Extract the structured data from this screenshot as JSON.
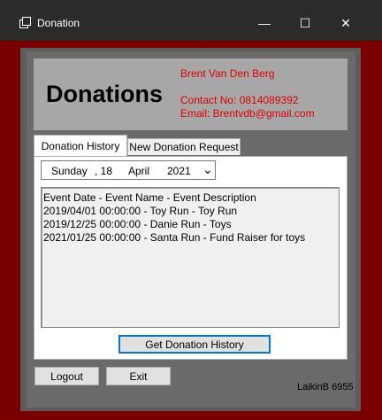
{
  "window": {
    "title": "Donation",
    "minimize_glyph": "—",
    "maximize_glyph": "☐",
    "close_glyph": "✕"
  },
  "header": {
    "title": "Donations",
    "name": "Brent Van Den Berg",
    "contact": "Contact No: 0814089392",
    "email": "Email: Brentvdb@gmail.com"
  },
  "tabs": [
    {
      "label": "Donation History",
      "active": true
    },
    {
      "label": "New Donation Request",
      "active": false
    }
  ],
  "date_picker": {
    "weekday": "Sunday",
    "comma_day": ", 18",
    "month": "April",
    "year": "2021",
    "dropdown_glyph": "⌄"
  },
  "history_list": {
    "items": [
      "Event Date - Event Name - Event Description",
      "2019/04/01 00:00:00 - Toy Run - Toy Run",
      "2019/12/25 00:00:00 - Danie Run - Toys",
      "2021/01/25 00:00:00 - Santa Run - Fund Raiser for toys"
    ]
  },
  "buttons": {
    "get_history": "Get Donation History",
    "logout": "Logout",
    "exit": "Exit"
  },
  "footer": {
    "label": "LaikinB 6955"
  },
  "colors": {
    "outer_border": "#7a0000",
    "accent_red": "#e00000",
    "focus_blue": "#0078d7"
  }
}
